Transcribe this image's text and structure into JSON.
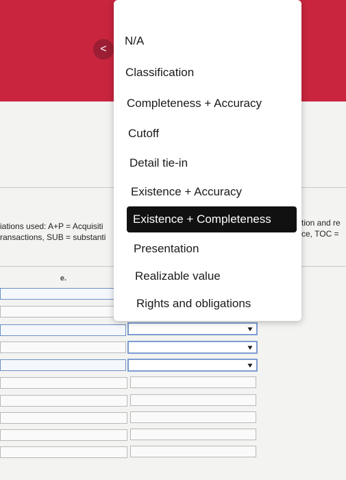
{
  "header": {
    "back_icon": "<"
  },
  "left_text": {
    "line1": "iations used: A+P = Acquisiti",
    "line2": "ransactions, SUB = substanti"
  },
  "right_text": {
    "line1": "tion and re",
    "line2": "ce, TOC ="
  },
  "table": {
    "column_label": "e."
  },
  "dropdown": {
    "options": [
      "N/A",
      "Classification",
      "Completeness + Accuracy",
      "Cutoff",
      "Detail tie-in",
      "Existence + Accuracy",
      "Existence + Completeness",
      "Presentation",
      "Realizable value",
      "Rights and obligations"
    ],
    "selected": "Existence + Completeness"
  }
}
